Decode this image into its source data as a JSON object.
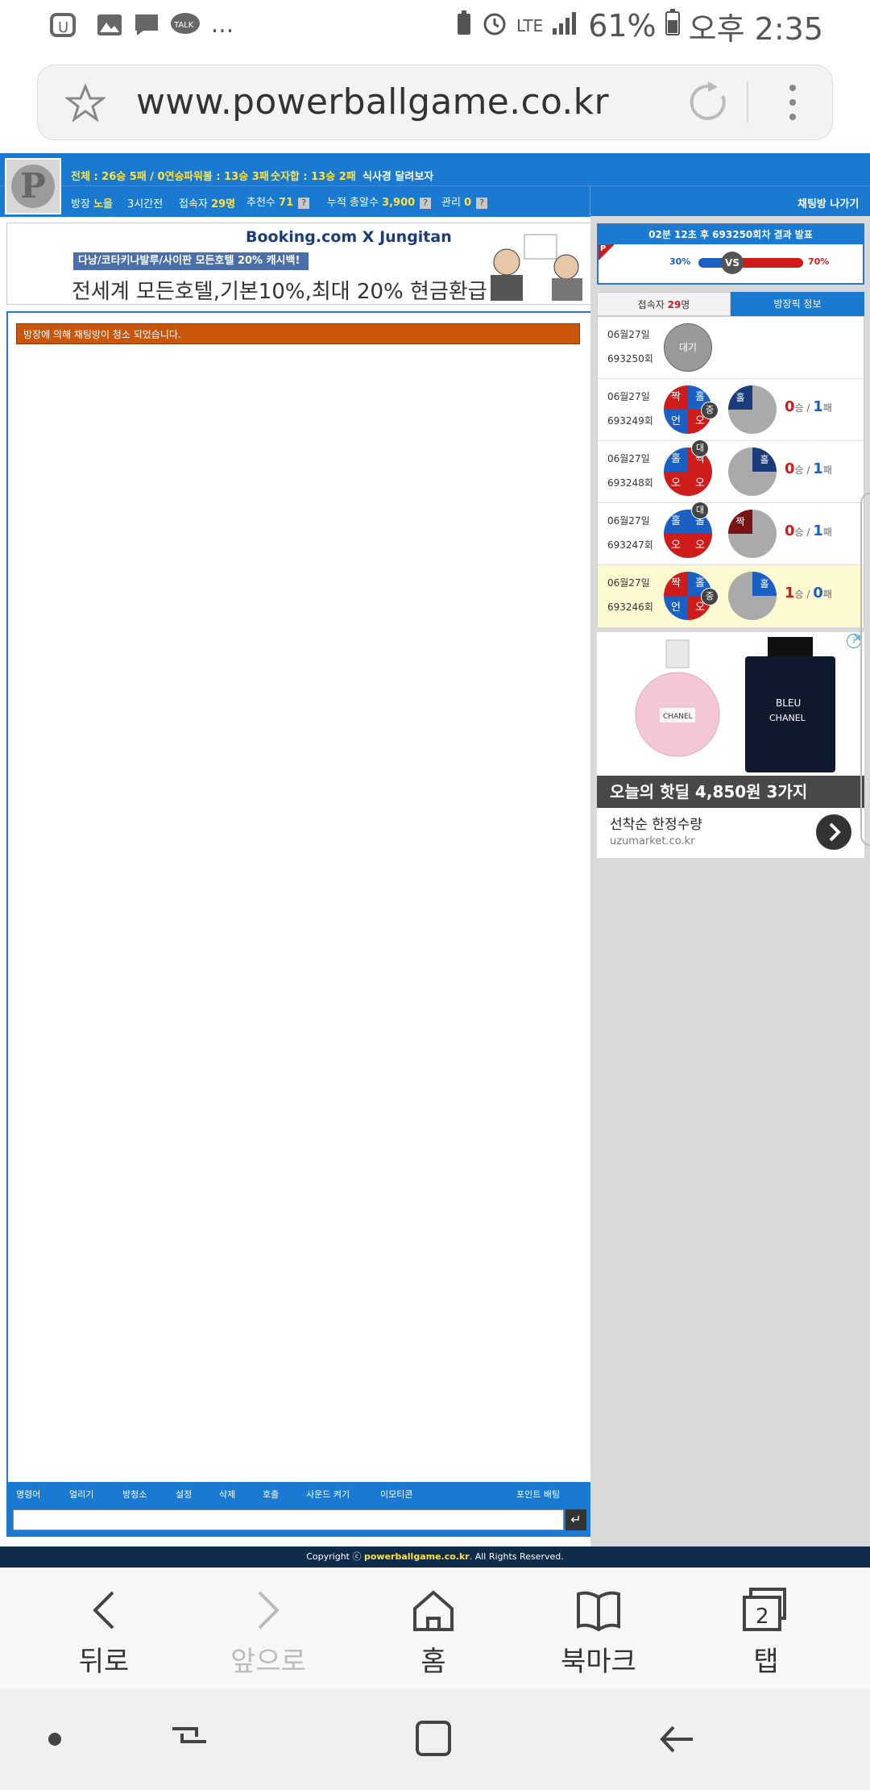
{
  "status_bar": {
    "talk_label": "TALK",
    "more": "...",
    "network": "LTE",
    "battery": "61%",
    "time": "오후 2:35"
  },
  "browser": {
    "url": "www.powerballgame.co.kr"
  },
  "header": {
    "stats": [
      {
        "label": "전체 : ",
        "value": "26승 5패 / 0연승"
      },
      {
        "label": "파워볼 : ",
        "value": "13승 3패"
      },
      {
        "label": "숫자합 : ",
        "value": "13승 2패"
      }
    ],
    "room_title": "식사경 달려보자",
    "sub": {
      "owner_label": "방장",
      "owner_value": "노을",
      "time_label": "3시간전",
      "visitors_label": "접속자",
      "visitors_value": "29명",
      "recommend_label": "추천수",
      "recommend_value": "71",
      "total_label": "누적 총알수",
      "total_value": "3,900",
      "manage_label": "관리",
      "manage_value": "0",
      "help": "?"
    },
    "exit_button": "채팅방 나가기"
  },
  "ad_banner": {
    "brand": "Booking.com X Jungitan",
    "promo": "다낭/코타키나발루/사이판 모든호텔 20% 캐시백!",
    "headline": "전세계 모든호텔,기본10%,최대 20% 현금환급"
  },
  "chat": {
    "notice": "방장에 의해 채팅방이 청소 되었습니다.",
    "toolbar": [
      "명령어",
      "얼리기",
      "방청소",
      "설정",
      "삭제",
      "호출",
      "사운드 켜기",
      "이모티콘"
    ],
    "point_bet": "포인트 배팅",
    "send_icon": "↵"
  },
  "result": {
    "title": "02분 12초 후 693250회차 결과 발표",
    "left_pct": "30%",
    "vs": "VS",
    "right_pct": "70%",
    "p_mark": "P"
  },
  "tabs": {
    "visitors_label": "접속자",
    "visitors_value": "29",
    "visitors_unit": "명",
    "info": "방장픽 정보"
  },
  "picks": [
    {
      "date": "06월27일",
      "round": "693250회",
      "status": "대기"
    },
    {
      "date": "06월27일",
      "round": "693249회",
      "q": [
        "짝",
        "홀",
        "언",
        "오"
      ],
      "badge": "중",
      "p": "홀",
      "win": "0",
      "loss": "1"
    },
    {
      "date": "06월27일",
      "round": "693248회",
      "q": [
        "홀",
        "짝",
        "오",
        "오"
      ],
      "badge": "대",
      "p": "홀",
      "win": "0",
      "loss": "1"
    },
    {
      "date": "06월27일",
      "round": "693247회",
      "q": [
        "홀",
        "홀",
        "오",
        "오"
      ],
      "badge": "대",
      "p": "짝",
      "win": "0",
      "loss": "1"
    },
    {
      "date": "06월27일",
      "round": "693246회",
      "q": [
        "짝",
        "홀",
        "언",
        "오"
      ],
      "badge": "중",
      "p": "홀",
      "win": "1",
      "loss": "0"
    }
  ],
  "score_labels": {
    "win": "승",
    "sep": "/",
    "loss": "패"
  },
  "ad2": {
    "brand_left": "CHANEL",
    "brand_right_top": "BLEU",
    "brand_right_bottom": "CHANEL",
    "headline": "오늘의 핫딜 4,850원 3가지",
    "sub": "선착순 한정수량",
    "domain": "uzumarket.co.kr"
  },
  "footer": {
    "copyright_prefix": "Copyright ⓒ ",
    "site": "powerballgame.co.kr",
    "copyright_suffix": ". All Rights Reserved."
  },
  "browser_nav": {
    "back": "뒤로",
    "forward": "앞으로",
    "home": "홈",
    "bookmark": "북마크",
    "tabs": "탭",
    "tab_count": "2"
  }
}
